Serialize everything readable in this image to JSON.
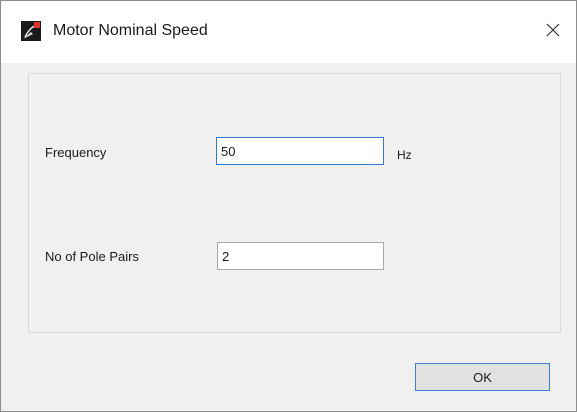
{
  "window": {
    "title": "Motor Nominal Speed",
    "close_glyph": "×"
  },
  "form": {
    "frequency": {
      "label": "Frequency",
      "value": "50",
      "unit": "Hz",
      "focused": true
    },
    "pole_pairs": {
      "label": "No of Pole Pairs",
      "value": "2"
    }
  },
  "buttons": {
    "ok_label": "OK"
  },
  "icons": {
    "app": "motor-app-icon",
    "close": "close-icon"
  },
  "colors": {
    "focus_border": "#2f7ad0",
    "button_default_border": "#3c7fd4"
  }
}
